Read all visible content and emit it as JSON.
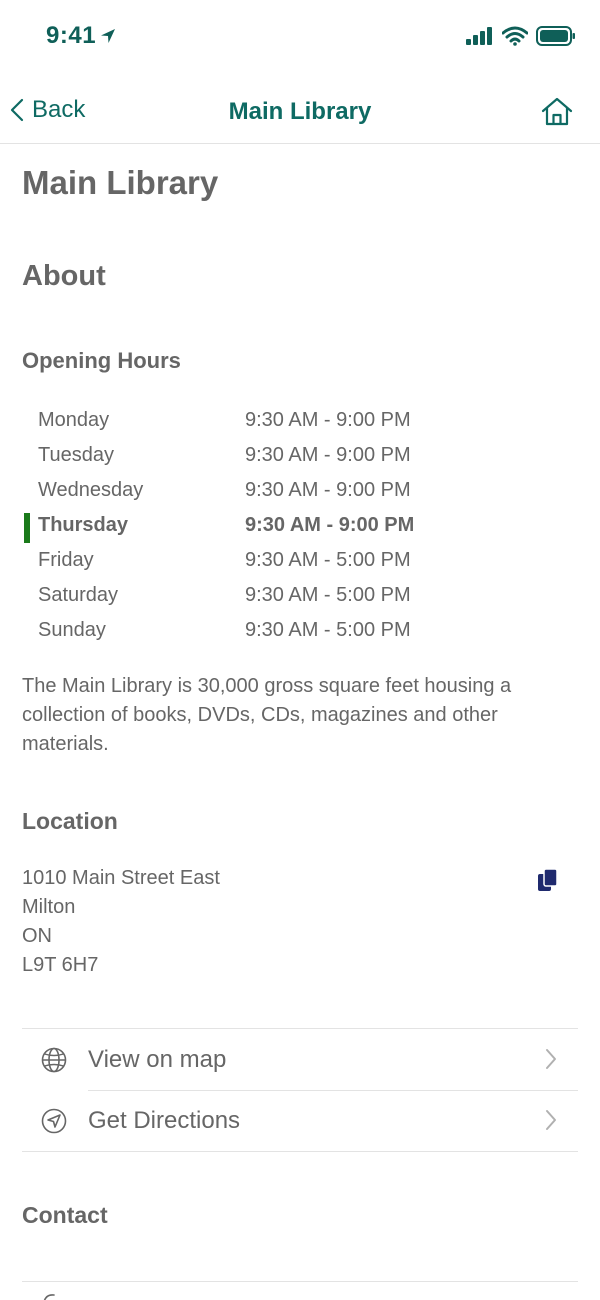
{
  "status_bar": {
    "time": "9:41",
    "location_icon": "location-arrow-icon",
    "signal_icon": "cellular-signal-icon",
    "wifi_icon": "wifi-icon",
    "battery_icon": "battery-icon"
  },
  "nav": {
    "back_label": "Back",
    "title": "Main Library",
    "home_icon": "home-icon"
  },
  "colors": {
    "accent": "#0e6a63",
    "text": "#666666",
    "today_marker": "#1a7a1a",
    "copy_icon": "#1f2a6e",
    "divider": "#e3e3e3"
  },
  "page": {
    "title": "Main Library",
    "about_heading": "About",
    "hours_heading": "Opening Hours",
    "hours": [
      {
        "day": "Monday",
        "time": "9:30 AM - 9:00 PM",
        "today": false
      },
      {
        "day": "Tuesday",
        "time": "9:30 AM - 9:00 PM",
        "today": false
      },
      {
        "day": "Wednesday",
        "time": "9:30 AM - 9:00 PM",
        "today": false
      },
      {
        "day": "Thursday",
        "time": "9:30 AM - 9:00 PM",
        "today": true
      },
      {
        "day": "Friday",
        "time": "9:30 AM - 5:00 PM",
        "today": false
      },
      {
        "day": "Saturday",
        "time": "9:30 AM - 5:00 PM",
        "today": false
      },
      {
        "day": "Sunday",
        "time": "9:30 AM - 5:00 PM",
        "today": false
      }
    ],
    "description": "The Main Library is 30,000 gross square feet housing a collection of books, DVDs, CDs, magazines and other materials.",
    "location_heading": "Location",
    "address": [
      "1010 Main Street East",
      "Milton",
      "ON",
      "L9T 6H7"
    ],
    "copy_icon": "copy-icon",
    "links": [
      {
        "label": "View on map",
        "icon": "globe-icon"
      },
      {
        "label": "Get Directions",
        "icon": "compass-arrow-icon"
      }
    ],
    "contact_heading": "Contact"
  }
}
